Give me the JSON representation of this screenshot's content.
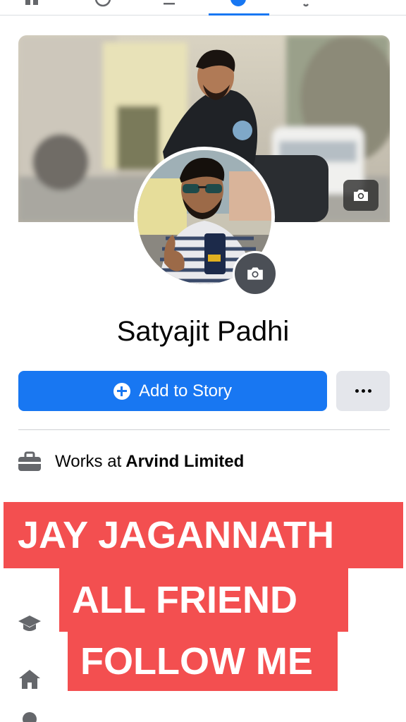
{
  "nav": {
    "icons": [
      "home-icon",
      "watch-icon",
      "marketplace-icon",
      "profile-icon",
      "notifications-icon"
    ],
    "active_color": "#1877f2"
  },
  "profile": {
    "name": "Satyajit Padhi",
    "add_story_label": "Add to Story"
  },
  "about": {
    "work": {
      "prefix": "Works at",
      "value": "Arvind Limited"
    }
  },
  "overlay": {
    "line1": "JAY JAGANNATH",
    "line2": "ALL FRIEND",
    "line3": "FOLLOW ME",
    "color": "#f34f50"
  },
  "colors": {
    "primary": "#1877f2",
    "secondary_button": "#e4e6eb",
    "divider": "#ced0d4"
  }
}
